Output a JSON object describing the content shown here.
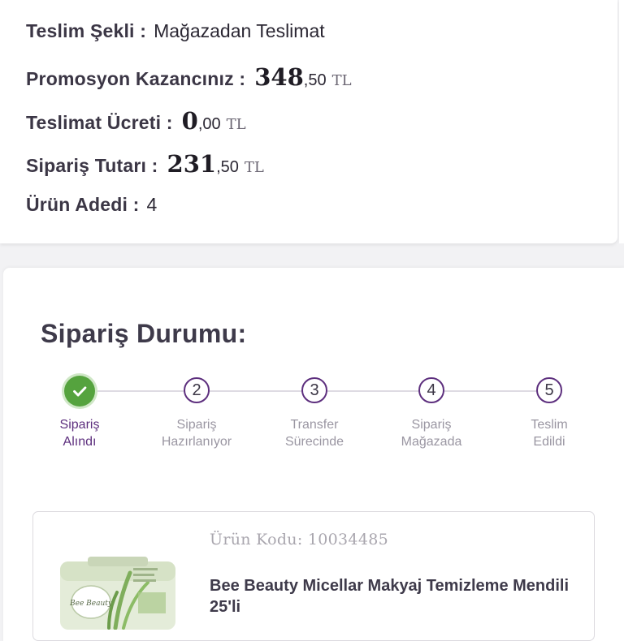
{
  "summary": {
    "delivery_method": {
      "label": "Teslim Şekli :",
      "value": "Mağazadan Teslimat"
    },
    "promotion_savings": {
      "label": "Promosyon Kazancınız :",
      "integer": "348",
      "decimal": ",50",
      "currency": "TL"
    },
    "delivery_fee": {
      "label": "Teslimat Ücreti :",
      "integer": "0",
      "decimal": ",00",
      "currency": "TL"
    },
    "order_total": {
      "label": "Sipariş Tutarı :",
      "integer": "231",
      "decimal": ",50",
      "currency": "TL"
    },
    "item_count": {
      "label": "Ürün Adedi :",
      "value": "4"
    }
  },
  "order_status": {
    "title": "Sipariş Durumu:",
    "steps": [
      {
        "number": "",
        "label": "Sipariş\nAlındı",
        "state": "completed"
      },
      {
        "number": "2",
        "label": "Sipariş\nHazırlanıyor",
        "state": "pending"
      },
      {
        "number": "3",
        "label": "Transfer\nSürecinde",
        "state": "pending"
      },
      {
        "number": "4",
        "label": "Sipariş\nMağazada",
        "state": "pending"
      },
      {
        "number": "5",
        "label": "Teslim\nEdildi",
        "state": "pending"
      }
    ]
  },
  "product": {
    "code": "Ürün Kodu: 10034485",
    "name": "Bee Beauty Micellar Makyaj Temizleme Mendili 25'li",
    "packaging_text": "Bee Beauty"
  },
  "colors": {
    "accent_purple": "#5d2f7e",
    "success_green": "#55a33e",
    "muted_text": "#9a96a2"
  }
}
